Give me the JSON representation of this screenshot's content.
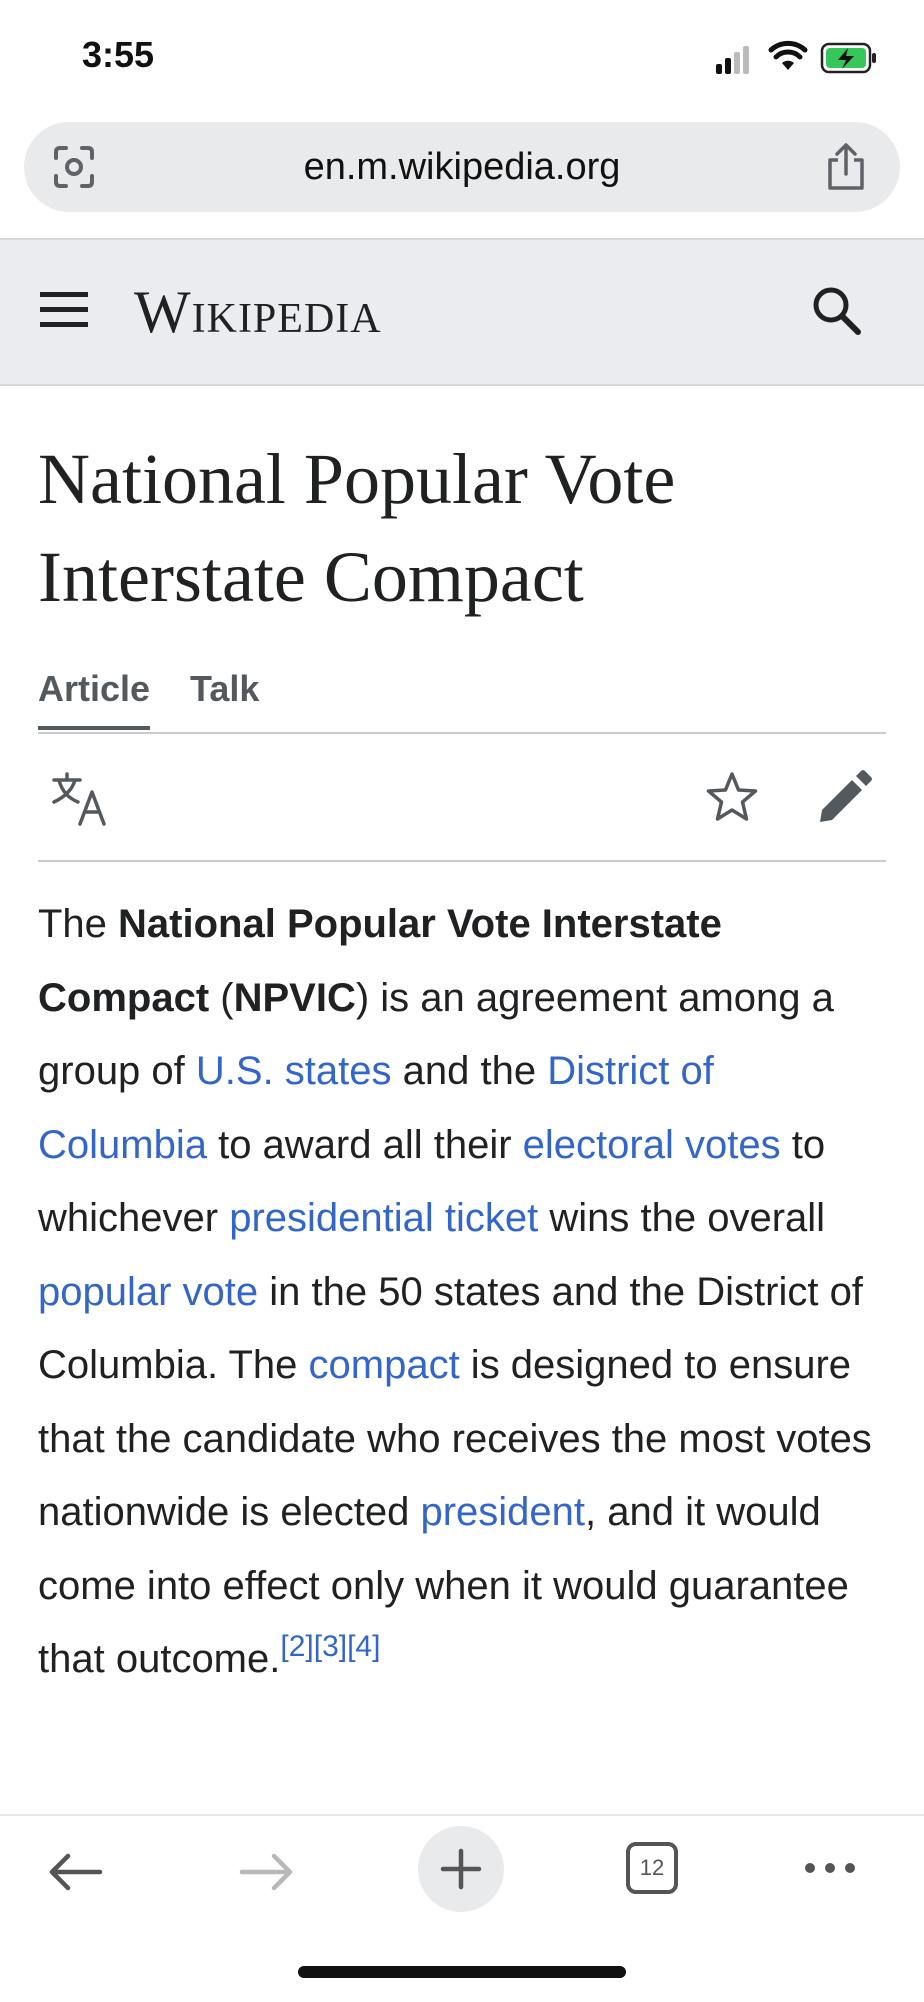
{
  "status_bar": {
    "time": "3:55"
  },
  "browser": {
    "url": "en.m.wikipedia.org",
    "open_tab_count": "12"
  },
  "wiki_header": {
    "logo": "Wikipedia"
  },
  "page": {
    "title_line1": "National Popular Vote",
    "title_line2": "Interstate Compact",
    "tabs": [
      {
        "label": "Article",
        "active": true
      },
      {
        "label": "Talk",
        "active": false
      }
    ]
  },
  "article": {
    "t1": "The ",
    "b1": "National Popular Vote Interstate Compact",
    "t2": " (",
    "b2": "NPVIC",
    "t3": ") is an agreement among a group of ",
    "l1": "U.S. states",
    "t4": " and the ",
    "l2": "District of Columbia",
    "t5": " to award all their ",
    "l3": "electoral votes",
    "t6": " to whichever ",
    "l4": "presidential ticket",
    "t7": " wins the overall ",
    "l5": "popular vote",
    "t8": " in the 50 states and the District of Columbia. The ",
    "l6": "compact",
    "t9": " is designed to ensure that the candidate who receives the most votes nationwide is elected ",
    "l7": "president",
    "t10": ", and it would come into effect only when it would guarantee that outcome.",
    "refs": [
      "[2]",
      "[3]",
      "[4]"
    ]
  },
  "colors": {
    "link": "#3366cc",
    "header_bg": "#eaecf0",
    "text": "#202122"
  }
}
